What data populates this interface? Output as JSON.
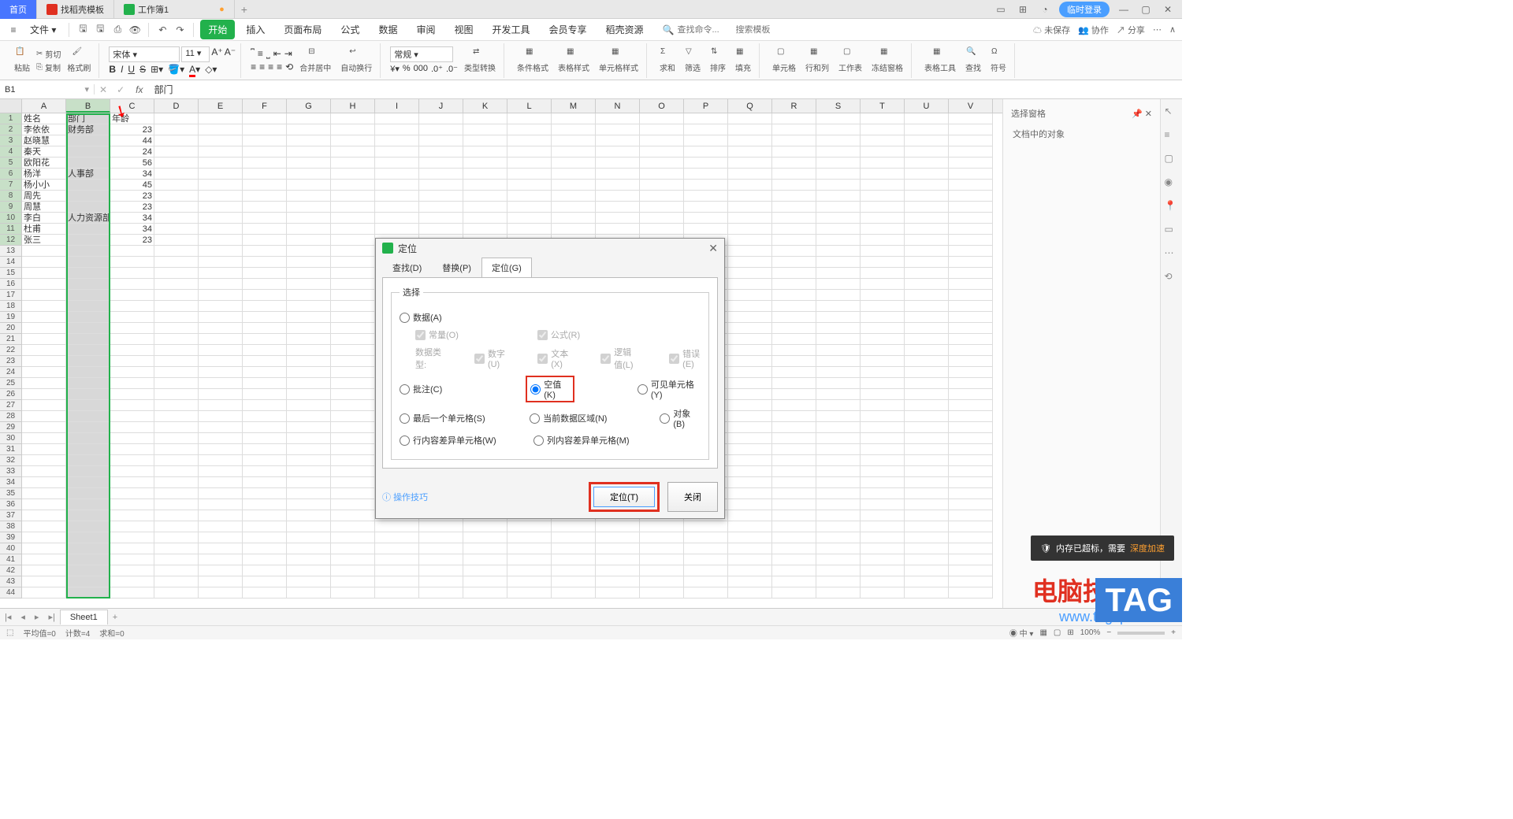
{
  "titlebar": {
    "home": "首页",
    "tab1": "找稻壳模板",
    "tab2": "工作簿1",
    "login": "临时登录"
  },
  "menu": {
    "file": "文件"
  },
  "ribbon_tabs": [
    "开始",
    "插入",
    "页面布局",
    "公式",
    "数据",
    "审阅",
    "视图",
    "开发工具",
    "会员专享",
    "稻壳资源"
  ],
  "search": {
    "find": "查找命令...",
    "template": "搜索模板"
  },
  "top_right": {
    "unsaved": "未保存",
    "coop": "协作",
    "share": "分享"
  },
  "ribbon": {
    "paste": "粘贴",
    "cut": "剪切",
    "copy": "复制",
    "format": "格式刷",
    "font": "宋体",
    "size": "11",
    "merge": "合并居中",
    "wrap": "自动换行",
    "general": "常规",
    "typeconv": "类型转换",
    "condformat": "条件格式",
    "tablestyle": "表格样式",
    "cellstyle": "单元格样式",
    "sum": "求和",
    "filter": "筛选",
    "sort": "排序",
    "fill": "填充",
    "cell": "单元格",
    "rowcol": "行和列",
    "worksheet": "工作表",
    "freeze": "冻结窗格",
    "tabletool": "表格工具",
    "find2": "查找",
    "symbol": "符号"
  },
  "namebox": "B1",
  "formula": "部门",
  "columns": [
    "A",
    "B",
    "C",
    "D",
    "E",
    "F",
    "G",
    "H",
    "I",
    "J",
    "K",
    "L",
    "M",
    "N",
    "O",
    "P",
    "Q",
    "R",
    "S",
    "T",
    "U",
    "V"
  ],
  "data_rows": [
    {
      "a": "姓名",
      "b": "部门",
      "c": "年龄"
    },
    {
      "a": "李依依",
      "b": "财务部",
      "c": "23"
    },
    {
      "a": "赵晓慧",
      "b": "",
      "c": "44"
    },
    {
      "a": "秦天",
      "b": "",
      "c": "24"
    },
    {
      "a": "欧阳花",
      "b": "",
      "c": "56"
    },
    {
      "a": "杨洋",
      "b": "人事部",
      "c": "34"
    },
    {
      "a": "杨小小",
      "b": "",
      "c": "45"
    },
    {
      "a": "周先",
      "b": "",
      "c": "23"
    },
    {
      "a": "周慧",
      "b": "",
      "c": "23"
    },
    {
      "a": "李白",
      "b": "人力资源部",
      "c": "34"
    },
    {
      "a": "杜甫",
      "b": "",
      "c": "34"
    },
    {
      "a": "张三",
      "b": "",
      "c": "23"
    }
  ],
  "dialog": {
    "title": "定位",
    "tabs": [
      "查找(D)",
      "替换(P)",
      "定位(G)"
    ],
    "legend": "选择",
    "opt_data": "数据(A)",
    "ck_const": "常量(O)",
    "ck_formula": "公式(R)",
    "datatype": "数据类型:",
    "ck_num": "数字(U)",
    "ck_text": "文本(X)",
    "ck_logic": "逻辑值(L)",
    "ck_err": "错误(E)",
    "opt_comment": "批注(C)",
    "opt_blank": "空值(K)",
    "opt_visible": "可见单元格(Y)",
    "opt_last": "最后一个单元格(S)",
    "opt_region": "当前数据区域(N)",
    "opt_object": "对象(B)",
    "opt_rowdiff": "行内容差异单元格(W)",
    "opt_coldiff": "列内容差异单元格(M)",
    "tip": "操作技巧",
    "btn_ok": "定位(T)",
    "btn_close": "关闭"
  },
  "right_panel": {
    "title": "选择窗格",
    "sub": "文档中的对象"
  },
  "sheet": "Sheet1",
  "status": {
    "avg": "平均值=0",
    "count": "计数=4",
    "sum": "求和=0",
    "zoom": "100%"
  },
  "toast": {
    "msg": "内存已超标，需要",
    "action": "深度加速"
  },
  "wm1": "电脑技术网",
  "wm2": "www.tagxp.com",
  "tag": "TAG"
}
